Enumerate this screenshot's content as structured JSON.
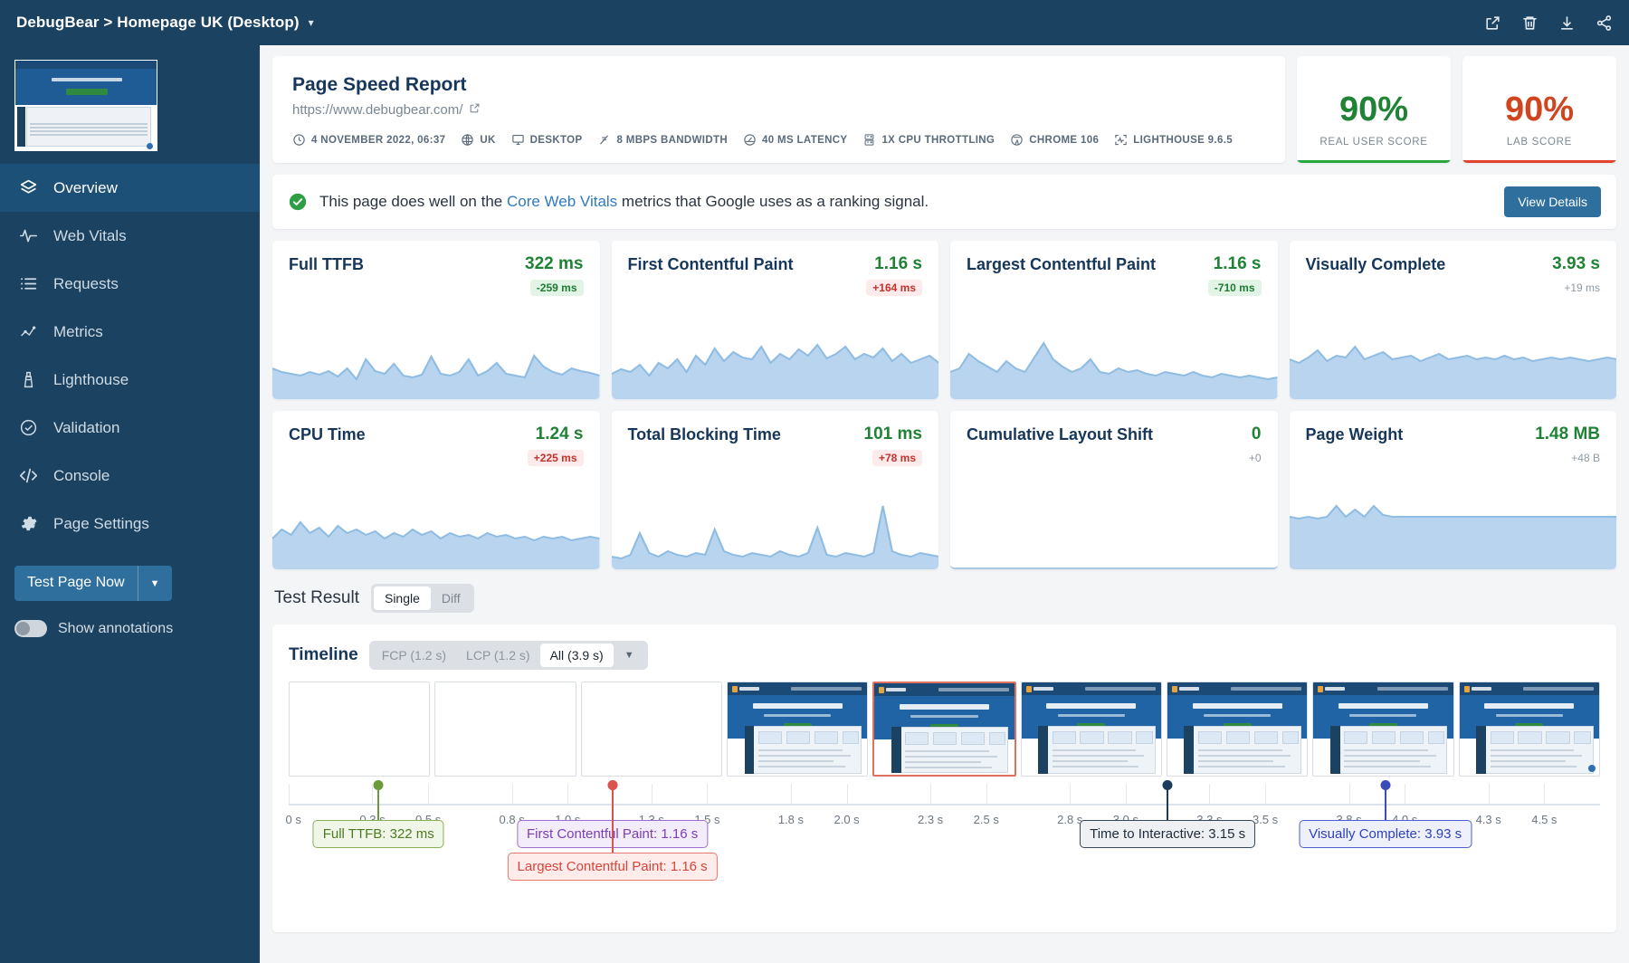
{
  "topbar": {
    "title": "DebugBear > Homepage UK (Desktop)",
    "caret": "▾",
    "actions": [
      {
        "name": "open-external-icon",
        "label": "Open in new tab"
      },
      {
        "name": "delete-icon",
        "label": "Delete"
      },
      {
        "name": "download-icon",
        "label": "Download"
      },
      {
        "name": "share-icon",
        "label": "Share"
      }
    ]
  },
  "sidebar": {
    "items": [
      {
        "label": "Overview",
        "icon": "layers-icon",
        "active": true
      },
      {
        "label": "Web Vitals",
        "icon": "pulse-icon",
        "active": false
      },
      {
        "label": "Requests",
        "icon": "list-icon",
        "active": false
      },
      {
        "label": "Metrics",
        "icon": "scatter-icon",
        "active": false
      },
      {
        "label": "Lighthouse",
        "icon": "lighthouse-icon",
        "active": false
      },
      {
        "label": "Validation",
        "icon": "check-circle-icon",
        "active": false
      },
      {
        "label": "Console",
        "icon": "code-icon",
        "active": false
      },
      {
        "label": "Page Settings",
        "icon": "gear-icon",
        "active": false
      }
    ],
    "test_button": {
      "label": "Test Page Now",
      "caret": "▼"
    },
    "annotations_toggle": {
      "label": "Show annotations",
      "on": false
    }
  },
  "report": {
    "title": "Page Speed Report",
    "url": "https://www.debugbear.com/",
    "external_icon": "external-link-icon",
    "meta": [
      {
        "icon": "clock-icon",
        "label": "4 NOVEMBER 2022, 06:37"
      },
      {
        "icon": "globe-icon",
        "label": "UK"
      },
      {
        "icon": "monitor-icon",
        "label": "DESKTOP"
      },
      {
        "icon": "bandwidth-icon",
        "label": "8 MBPS BANDWIDTH"
      },
      {
        "icon": "gauge-icon",
        "label": "40 MS LATENCY"
      },
      {
        "icon": "cpu-icon",
        "label": "1X CPU THROTTLING"
      },
      {
        "icon": "chrome-icon",
        "label": "CHROME 106"
      },
      {
        "icon": "lighthouse-frame-icon",
        "label": "LIGHTHOUSE 9.6.5"
      }
    ]
  },
  "scores": [
    {
      "value": "90%",
      "label": "REAL USER SCORE",
      "color": "#1f8235",
      "bar": "#27a83f"
    },
    {
      "value": "90%",
      "label": "LAB SCORE",
      "color": "#d0451f",
      "bar": "#e0442a"
    }
  ],
  "banner": {
    "icon": "check-circle-filled-icon",
    "text_before": "This page does well on the ",
    "link": "Core Web Vitals",
    "text_after": " metrics that Google uses as a ranking signal.",
    "button": "View Details"
  },
  "test_result": {
    "label": "Test Result",
    "options": [
      "Single",
      "Diff"
    ],
    "selected": "Single"
  },
  "timeline_controls": {
    "title": "Timeline",
    "options": [
      "FCP (1.2 s)",
      "LCP (1.2 s)",
      "All (3.9 s)"
    ],
    "selected": "All (3.9 s)",
    "caret": "▼"
  },
  "chart_data": {
    "type": "table",
    "title": "Page speed metric cards",
    "metrics": [
      {
        "name": "Full TTFB",
        "value": "322 ms",
        "delta": "-259 ms",
        "delta_kind": "good",
        "value_color": "#1f8235",
        "spark": [
          34,
          30,
          28,
          26,
          30,
          27,
          31,
          25,
          34,
          22,
          44,
          31,
          28,
          39,
          26,
          24,
          27,
          47,
          28,
          26,
          30,
          44,
          26,
          31,
          40,
          28,
          26,
          24,
          48,
          36,
          30,
          27,
          34,
          31,
          29,
          26
        ],
        "has_spark": true
      },
      {
        "name": "First Contentful Paint",
        "value": "1.16 s",
        "delta": "+164 ms",
        "delta_kind": "bad",
        "value_color": "#1f8235",
        "spark": [
          28,
          33,
          30,
          38,
          26,
          40,
          34,
          44,
          30,
          48,
          38,
          56,
          42,
          52,
          46,
          44,
          58,
          40,
          50,
          44,
          55,
          48,
          60,
          45,
          50,
          58,
          44,
          50,
          46,
          56,
          42,
          50,
          40,
          44,
          48,
          40
        ],
        "has_spark": true
      },
      {
        "name": "Largest Contentful Paint",
        "value": "1.16 s",
        "delta": "-710 ms",
        "delta_kind": "good",
        "value_color": "#1f8235",
        "spark": [
          30,
          34,
          50,
          42,
          36,
          30,
          42,
          34,
          30,
          46,
          62,
          44,
          36,
          30,
          34,
          44,
          30,
          28,
          34,
          30,
          32,
          28,
          26,
          30,
          28,
          26,
          30,
          26,
          24,
          28,
          26,
          24,
          26,
          24,
          22,
          24
        ],
        "has_spark": true
      },
      {
        "name": "Visually Complete",
        "value": "3.93 s",
        "delta": "+19 ms",
        "delta_kind": "flat",
        "value_color": "#1f8235",
        "spark": [
          44,
          40,
          46,
          54,
          42,
          48,
          46,
          58,
          44,
          48,
          52,
          44,
          46,
          48,
          42,
          46,
          50,
          44,
          46,
          48,
          44,
          46,
          44,
          48,
          44,
          46,
          42,
          44,
          46,
          44,
          46,
          44,
          42,
          44,
          46,
          44
        ],
        "has_spark": true
      },
      {
        "name": "CPU Time",
        "value": "1.24 s",
        "delta": "+225 ms",
        "delta_kind": "bad",
        "value_color": "#1f8235",
        "spark": [
          34,
          44,
          38,
          52,
          40,
          46,
          36,
          48,
          40,
          44,
          38,
          42,
          34,
          40,
          36,
          44,
          38,
          42,
          34,
          40,
          36,
          38,
          34,
          40,
          36,
          38,
          34,
          36,
          32,
          36,
          34,
          36,
          32,
          34,
          36,
          34
        ],
        "has_spark": true
      },
      {
        "name": "Total Blocking Time",
        "value": "101 ms",
        "delta": "+78 ms",
        "delta_kind": "bad",
        "value_color": "#1f8235",
        "spark": [
          14,
          12,
          16,
          40,
          18,
          14,
          20,
          16,
          14,
          18,
          16,
          44,
          20,
          16,
          14,
          18,
          16,
          14,
          20,
          16,
          14,
          18,
          46,
          16,
          14,
          18,
          16,
          14,
          18,
          70,
          20,
          16,
          14,
          18,
          16,
          14
        ],
        "has_spark": true
      },
      {
        "name": "Cumulative Layout Shift",
        "value": "0",
        "delta": "+0",
        "delta_kind": "flat",
        "value_color": "#1f8235",
        "spark": [],
        "has_spark": false
      },
      {
        "name": "Page Weight",
        "value": "1.48 MB",
        "delta": "+48 B",
        "delta_kind": "flat",
        "value_color": "#1f8235",
        "spark": [
          58,
          56,
          58,
          56,
          58,
          70,
          58,
          66,
          58,
          70,
          60,
          58,
          58,
          58,
          58,
          58,
          58,
          58,
          58,
          58,
          58,
          58,
          58,
          58,
          58,
          58,
          58,
          58,
          58,
          58,
          58,
          58,
          58,
          58,
          58,
          58
        ],
        "has_spark": true
      }
    ]
  },
  "timeline": {
    "axis_ticks": [
      "0 s",
      "0.3 s",
      "0.5 s",
      "0.8 s",
      "1.0 s",
      "1.3 s",
      "1.5 s",
      "1.8 s",
      "2.0 s",
      "2.3 s",
      "2.5 s",
      "2.8 s",
      "3.0 s",
      "3.3 s",
      "3.5 s",
      "3.8 s",
      "4.0 s",
      "4.3 s",
      "4.5 s"
    ],
    "axis_max_s": 4.7,
    "frames": [
      {
        "blank": true,
        "selected": false
      },
      {
        "blank": true,
        "selected": false
      },
      {
        "blank": true,
        "selected": false
      },
      {
        "blank": false,
        "selected": false
      },
      {
        "blank": false,
        "selected": true
      },
      {
        "blank": false,
        "selected": false
      },
      {
        "blank": false,
        "selected": false
      },
      {
        "blank": false,
        "selected": false
      },
      {
        "blank": false,
        "selected": false
      }
    ],
    "markers": [
      {
        "label": "Full TTFB: 322 ms",
        "time_s": 0.322,
        "color": "#6a9a3a",
        "bg": "#f0f7e8",
        "border": "#8ab055",
        "text": "#4d7a22",
        "row": 0
      },
      {
        "label": "First Contentful Paint: 1.16 s",
        "time_s": 1.16,
        "color": "#d9534f",
        "bg": "#f3ecfb",
        "border": "#9d6fd0",
        "text": "#7a3fb5",
        "row": 0
      },
      {
        "label": "Largest Contentful Paint: 1.16 s",
        "time_s": 1.16,
        "color": "#d9534f",
        "bg": "#fdecea",
        "border": "#e8776c",
        "text": "#d9443a",
        "row": 1
      },
      {
        "label": "Time to Interactive: 3.15 s",
        "time_s": 3.15,
        "color": "#1b3c5e",
        "bg": "#eef0f3",
        "border": "#37485c",
        "text": "#1e2b3a",
        "row": 0
      },
      {
        "label": "Visually Complete: 3.93 s",
        "time_s": 3.93,
        "color": "#3a4db8",
        "bg": "#eef1fb",
        "border": "#4b5fd0",
        "text": "#2f3fbe",
        "row": 0
      }
    ]
  }
}
